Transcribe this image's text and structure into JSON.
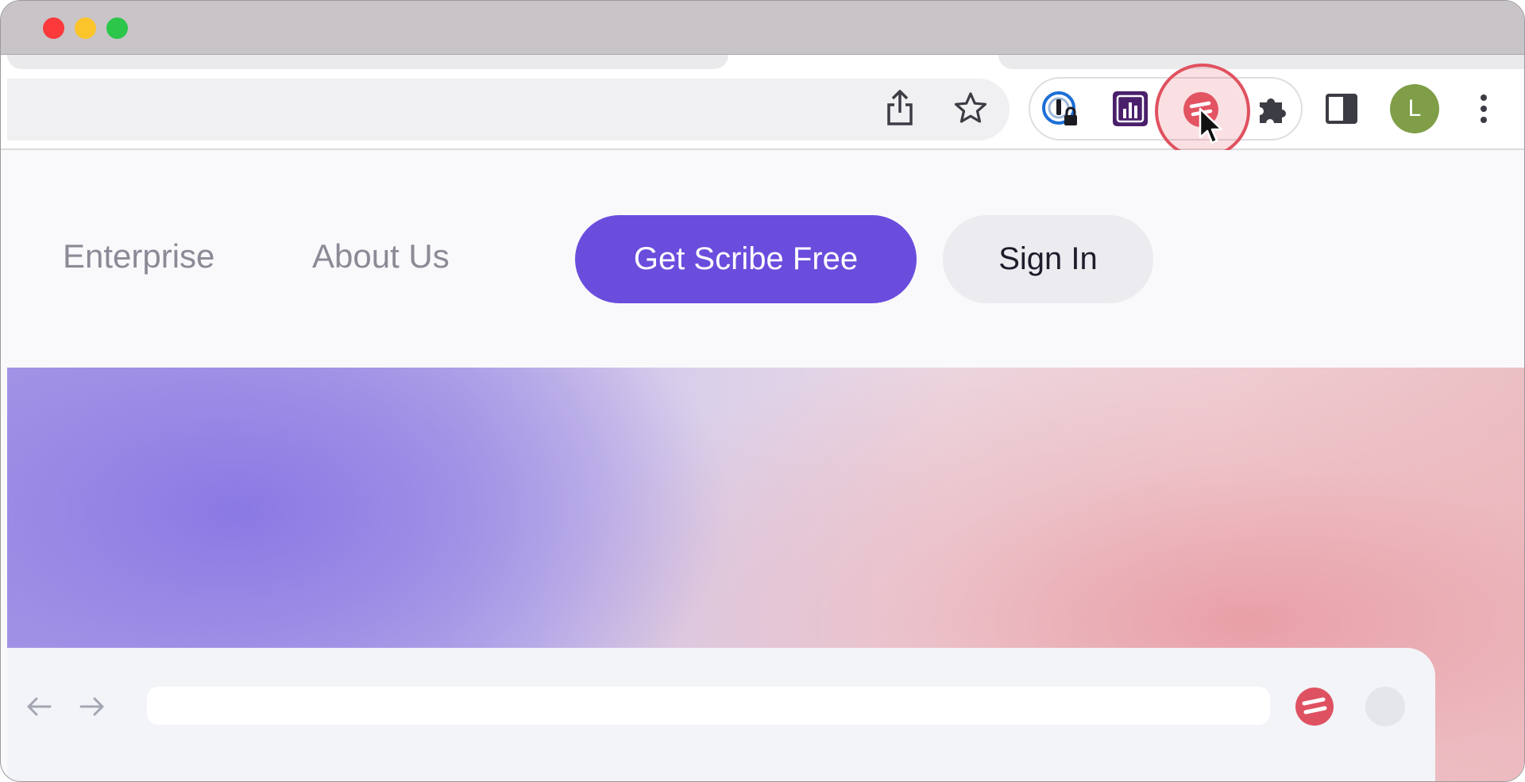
{
  "window": {
    "controls": [
      "close",
      "minimize",
      "maximize"
    ]
  },
  "toolbar": {
    "icons": [
      "share-icon",
      "bookmark-star-icon",
      "1password-icon",
      "analytics-extension-icon",
      "scribe-extension-icon",
      "extensions-puzzle-icon",
      "side-panel-icon",
      "more-menu-icon"
    ],
    "profile_initial": "L"
  },
  "site_nav": {
    "links": [
      "Enterprise",
      "About Us"
    ],
    "primary_button": "Get Scribe Free",
    "secondary_button": "Sign In"
  },
  "colors": {
    "primary": "#6a4ddd",
    "scribe_red": "#e0515f",
    "avatar": "#7f9e47"
  },
  "hero": {
    "mock_browser_icons": [
      "back-arrow-icon",
      "forward-arrow-icon",
      "scribe-logo-icon"
    ]
  }
}
